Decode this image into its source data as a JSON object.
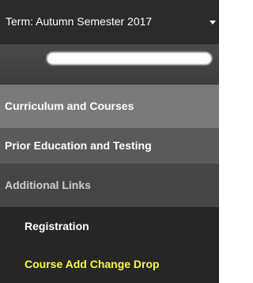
{
  "term": {
    "label": "Term: Autumn Semester 2017"
  },
  "menu": {
    "items": [
      {
        "label": "Curriculum and Courses"
      },
      {
        "label": "Prior Education and Testing"
      },
      {
        "label": "Additional Links"
      },
      {
        "label": "Registration"
      },
      {
        "label": "Course Add Change Drop"
      }
    ]
  },
  "colors": {
    "background": "#262626",
    "highlight_text": "#f3ff3c"
  },
  "icons": {
    "term_dropdown": "caret-down-icon"
  }
}
